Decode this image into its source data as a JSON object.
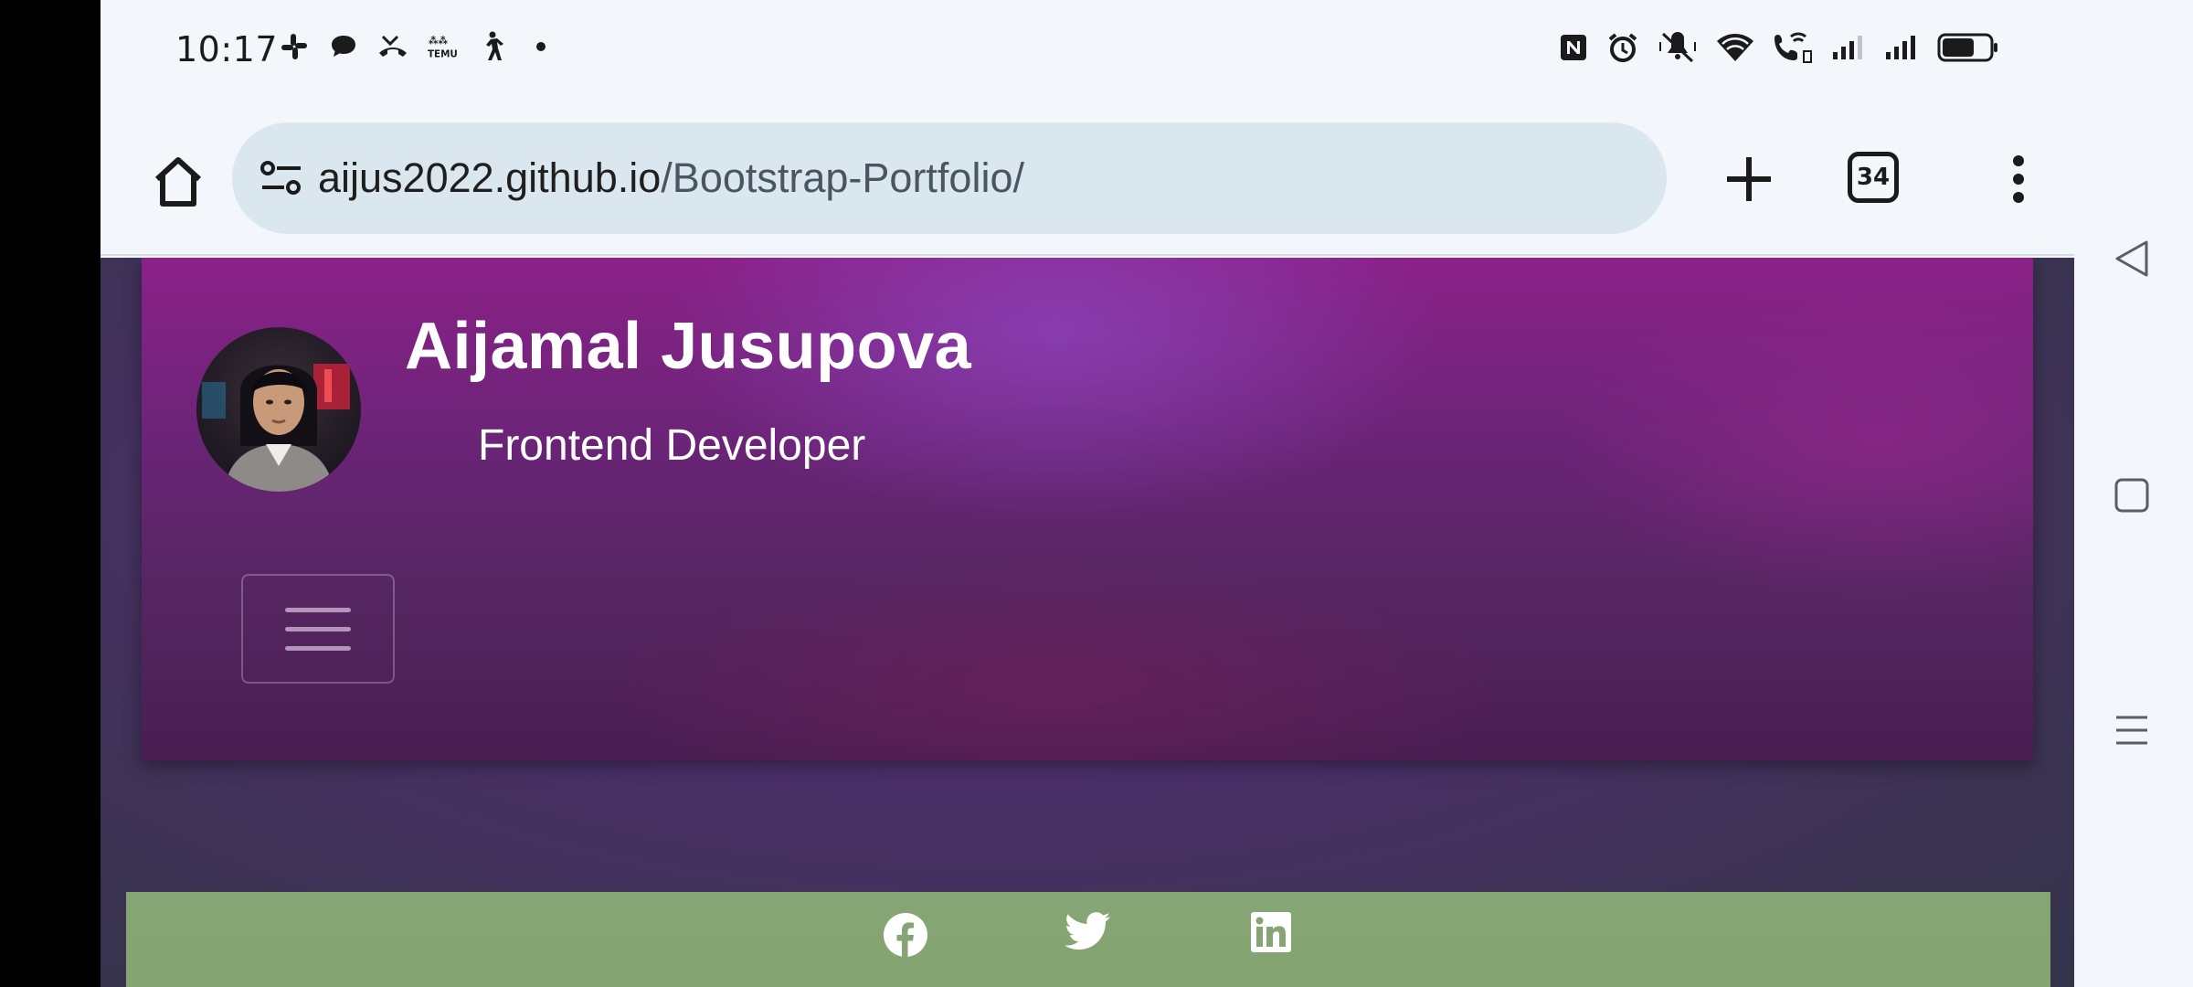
{
  "status_bar": {
    "time": "10:17",
    "left_icons": [
      "slack-icon",
      "chat-bubble-icon",
      "missed-call-icon",
      "temu-icon",
      "walking-icon",
      "dot-icon"
    ],
    "right_icons": [
      "nfc-icon",
      "alarm-icon",
      "vibrate-off-icon",
      "wifi-icon",
      "wifi-calling-icon",
      "signal-icon",
      "signal-icon",
      "battery-icon"
    ]
  },
  "browser": {
    "url_host": "aijus2022.github.io",
    "url_path": "/Bootstrap-Portfolio/",
    "tab_count": "34"
  },
  "hero": {
    "name": "Aijamal Jusupova",
    "role": "Frontend Developer"
  },
  "social": [
    "facebook-icon",
    "twitter-icon",
    "linkedin-icon"
  ],
  "colors": {
    "hero_top": "#8b2188",
    "hero_bottom": "#4a1e52",
    "social_strip": "#86a574",
    "urlbar_bg": "#dbe7ef"
  }
}
